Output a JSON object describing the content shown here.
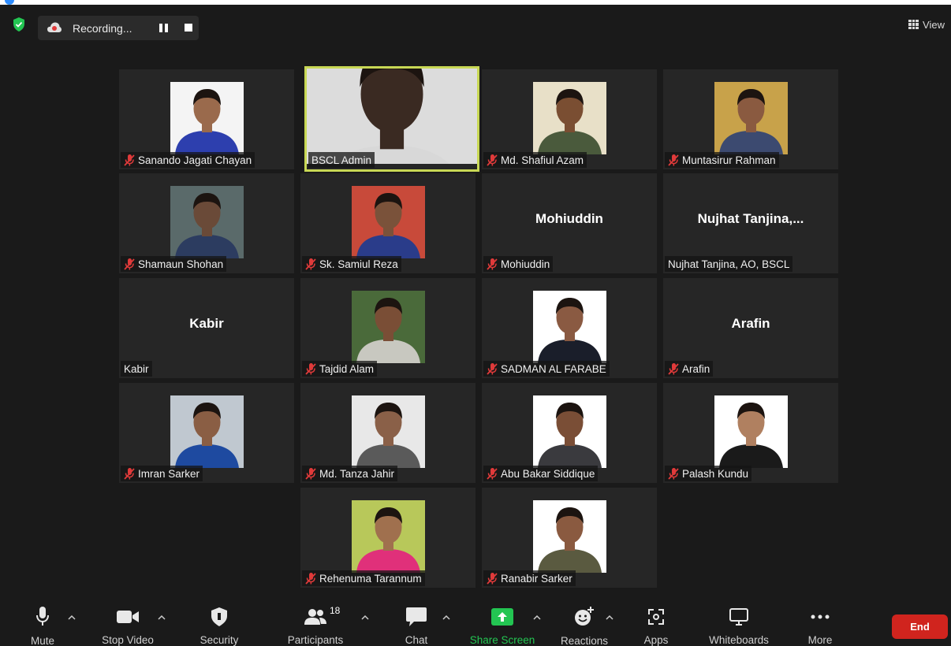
{
  "window": {
    "title_bar_color": "#ffffff"
  },
  "recording": {
    "label": "Recording..."
  },
  "view": {
    "label": "View"
  },
  "participants": [
    {
      "name": "Sanando Jagati Chayan",
      "muted": true,
      "has_video": true,
      "active": false,
      "shirt": "#2d3fae",
      "bg": "#f4f4f4",
      "skin": "#9a6a4c"
    },
    {
      "name": "BSCL Admin",
      "muted": false,
      "has_video": true,
      "active": true,
      "shirt": "#d8d8d8",
      "bg": "#dcdcdc",
      "skin": "#3a2a22"
    },
    {
      "name": "Md. Shafiul Azam",
      "muted": true,
      "has_video": true,
      "active": false,
      "shirt": "#4a5a3c",
      "bg": "#e8e0c8",
      "skin": "#7a4e32"
    },
    {
      "name": "Muntasirur Rahman",
      "muted": true,
      "has_video": true,
      "active": false,
      "shirt": "#3c4a70",
      "bg": "#c8a24a",
      "skin": "#8a5a40"
    },
    {
      "name": "Shamaun Shohan",
      "muted": true,
      "has_video": true,
      "active": false,
      "shirt": "#2c3c60",
      "bg": "#5a6a6a",
      "skin": "#6a4a38"
    },
    {
      "name": "Sk. Samiul Reza",
      "muted": true,
      "has_video": true,
      "active": false,
      "shirt": "#2a3c8a",
      "bg": "#c84a3a",
      "skin": "#7a523a"
    },
    {
      "name": "Mohiuddin",
      "display": "Mohiuddin",
      "muted": true,
      "has_video": false,
      "active": false
    },
    {
      "name": "Nujhat Tanjina, AO, BSCL",
      "display": "Nujhat Tanjina,...",
      "muted": false,
      "has_video": false,
      "active": false
    },
    {
      "name": "Kabir",
      "display": "Kabir",
      "muted": false,
      "has_video": false,
      "active": false
    },
    {
      "name": "Tajdid Alam",
      "muted": true,
      "has_video": true,
      "active": false,
      "shirt": "#c8c8c0",
      "bg": "#4a6a3a",
      "skin": "#7a4e36"
    },
    {
      "name": "SADMAN AL FARABE",
      "muted": true,
      "has_video": true,
      "active": false,
      "shirt": "#1a1e2a",
      "bg": "#ffffff",
      "skin": "#8a5a42"
    },
    {
      "name": "Arafin",
      "display": "Arafin",
      "muted": true,
      "has_video": false,
      "active": false
    },
    {
      "name": "Imran Sarker",
      "muted": true,
      "has_video": true,
      "active": false,
      "shirt": "#1e4aa0",
      "bg": "#c0c8d0",
      "skin": "#8a5e44"
    },
    {
      "name": "Md. Tanza Jahir",
      "muted": true,
      "has_video": true,
      "active": false,
      "shirt": "#5a5a5a",
      "bg": "#e8e8e8",
      "skin": "#8a6048"
    },
    {
      "name": "Abu Bakar Siddique",
      "muted": true,
      "has_video": true,
      "active": false,
      "shirt": "#3a3a3e",
      "bg": "#ffffff",
      "skin": "#7a4e36"
    },
    {
      "name": "Palash Kundu",
      "muted": true,
      "has_video": true,
      "active": false,
      "shirt": "#1a1a1a",
      "bg": "#ffffff",
      "skin": "#b08060"
    },
    {
      "name": "Rehenuma Tarannum",
      "muted": true,
      "has_video": true,
      "active": false,
      "shirt": "#e0307a",
      "bg": "#b8c85a",
      "skin": "#a0704e"
    },
    {
      "name": "Ranabir Sarker",
      "muted": true,
      "has_video": true,
      "active": false,
      "shirt": "#5a5a40",
      "bg": "#ffffff",
      "skin": "#8a5a40"
    }
  ],
  "toolbar": {
    "mute": "Mute",
    "stop_video": "Stop Video",
    "security": "Security",
    "participants": "Participants",
    "participants_count": "18",
    "chat": "Chat",
    "share_screen": "Share Screen",
    "reactions": "Reactions",
    "apps": "Apps",
    "whiteboards": "Whiteboards",
    "more": "More",
    "end": "End"
  },
  "colors": {
    "end": "#d0241e",
    "share": "#23c552",
    "active_border": "#c8d855",
    "mic_muted": "#e03a3a"
  }
}
